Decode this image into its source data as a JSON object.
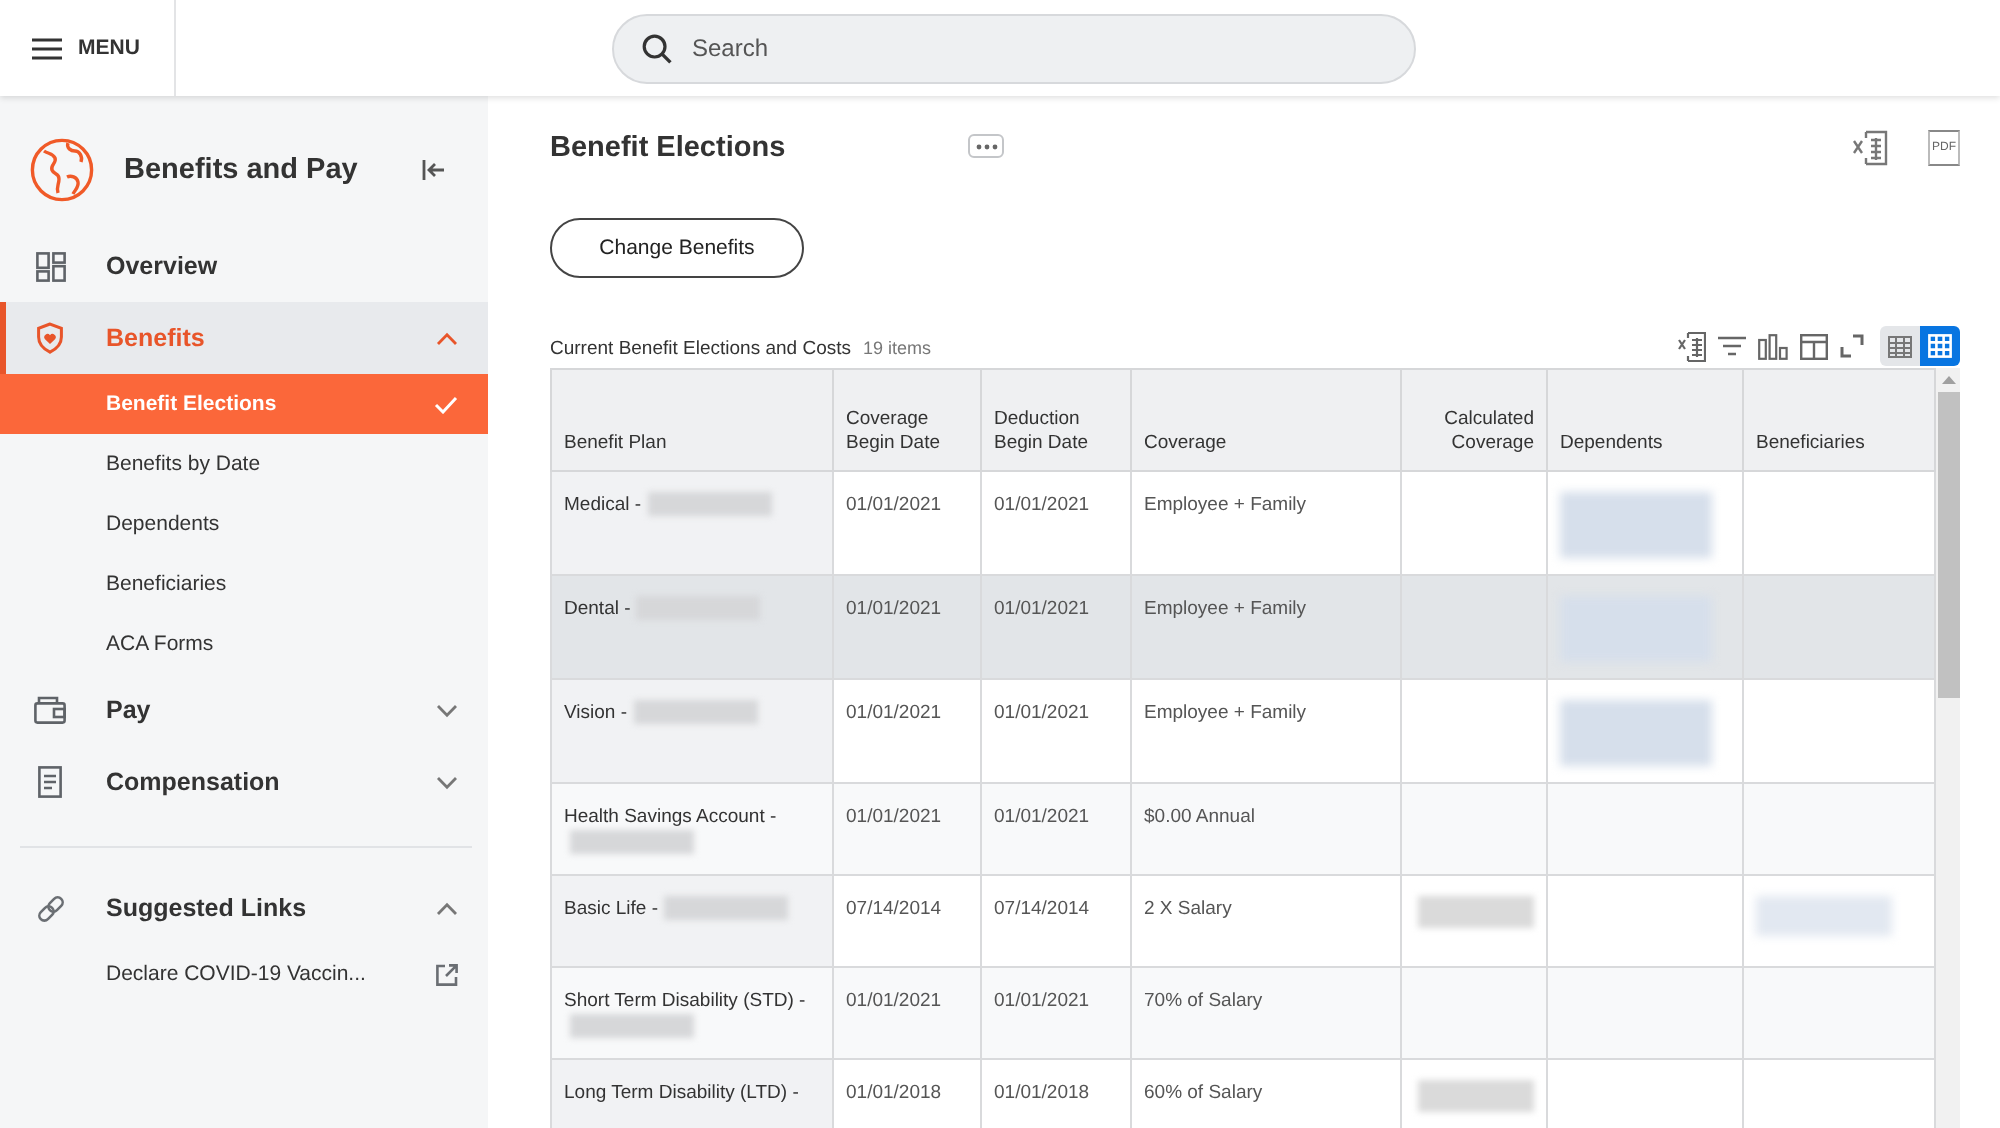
{
  "top_bar": {
    "menu_label": "MENU",
    "search": {
      "placeholder": "Search"
    }
  },
  "sidebar": {
    "title": "Benefits and Pay",
    "nav": [
      {
        "kind": "link",
        "label": "Overview",
        "selected": false
      },
      {
        "kind": "group",
        "label": "Benefits",
        "selected": true,
        "expanded": true,
        "children": [
          {
            "label": "Benefit Elections",
            "selected": true
          },
          {
            "label": "Benefits by Date",
            "selected": false
          },
          {
            "label": "Dependents",
            "selected": false
          },
          {
            "label": "Beneficiaries",
            "selected": false
          },
          {
            "label": "ACA Forms",
            "selected": false
          }
        ]
      },
      {
        "kind": "group",
        "label": "Pay",
        "selected": false,
        "expanded": false
      },
      {
        "kind": "group",
        "label": "Compensation",
        "selected": false,
        "expanded": false
      }
    ],
    "suggested": {
      "label": "Suggested Links",
      "expanded": true,
      "links": [
        {
          "label": "Declare COVID-19 Vaccin..."
        }
      ]
    }
  },
  "page": {
    "title": "Benefit Elections",
    "export_pdf_label": "PDF",
    "actions": [
      "Change Benefits"
    ]
  },
  "table": {
    "title": "Current Benefit Elections and Costs",
    "count": "19 items",
    "view_modes": [
      {
        "selected": false
      },
      {
        "selected": true
      }
    ],
    "columns": [
      {
        "label": "Benefit Plan",
        "kind": "label"
      },
      {
        "label": "Coverage Begin Date",
        "kind": "date"
      },
      {
        "label": "Deduction Begin Date",
        "kind": "date"
      },
      {
        "label": "Coverage",
        "kind": "text"
      },
      {
        "label": "Calculated Coverage",
        "kind": "number"
      },
      {
        "label": "Dependents",
        "kind": "text"
      },
      {
        "label": "Beneficiaries",
        "kind": "text"
      }
    ],
    "rows": [
      {
        "selected": false,
        "cells": [
          {
            "text": "Medical -",
            "redacted": true
          },
          {
            "text": "01/01/2021",
            "redacted": false
          },
          {
            "text": "01/01/2021",
            "redacted": false
          },
          {
            "text": "Employee + Family",
            "redacted": false
          },
          {
            "redacted": false
          },
          {
            "redacted": true
          },
          {
            "redacted": false
          }
        ]
      },
      {
        "selected": true,
        "cells": [
          {
            "text": "Dental -",
            "redacted": true
          },
          {
            "text": "01/01/2021",
            "redacted": false
          },
          {
            "text": "01/01/2021",
            "redacted": false
          },
          {
            "text": "Employee + Family",
            "redacted": false
          },
          {
            "redacted": false
          },
          {
            "redacted": true
          },
          {
            "redacted": false
          }
        ]
      },
      {
        "selected": false,
        "cells": [
          {
            "text": "Vision -",
            "redacted": true
          },
          {
            "text": "01/01/2021",
            "redacted": false
          },
          {
            "text": "01/01/2021",
            "redacted": false
          },
          {
            "text": "Employee + Family",
            "redacted": false
          },
          {
            "redacted": false
          },
          {
            "redacted": true
          },
          {
            "redacted": false
          }
        ]
      },
      {
        "selected": false,
        "cells": [
          {
            "text": "Health Savings Account -",
            "redacted": true
          },
          {
            "text": "01/01/2021",
            "redacted": false
          },
          {
            "text": "01/01/2021",
            "redacted": false
          },
          {
            "text": "$0.00 Annual",
            "redacted": false
          },
          {
            "redacted": false
          },
          {
            "redacted": false
          },
          {
            "redacted": false
          }
        ]
      },
      {
        "selected": false,
        "cells": [
          {
            "text": "Basic Life -",
            "redacted": true
          },
          {
            "text": "07/14/2014",
            "redacted": false
          },
          {
            "text": "07/14/2014",
            "redacted": false
          },
          {
            "text": "2 X Salary",
            "redacted": false
          },
          {
            "redacted": true
          },
          {
            "redacted": false
          },
          {
            "redacted": true
          }
        ]
      },
      {
        "selected": false,
        "cells": [
          {
            "text": "Short Term Disability (STD) -",
            "redacted": true
          },
          {
            "text": "01/01/2021",
            "redacted": false
          },
          {
            "text": "01/01/2021",
            "redacted": false
          },
          {
            "text": "70% of Salary",
            "redacted": false
          },
          {
            "redacted": false
          },
          {
            "redacted": false
          },
          {
            "redacted": false
          }
        ]
      },
      {
        "selected": false,
        "cells": [
          {
            "text": "Long Term Disability (LTD) -",
            "redacted": false
          },
          {
            "text": "01/01/2018",
            "redacted": false
          },
          {
            "text": "01/01/2018",
            "redacted": false
          },
          {
            "text": "60% of Salary",
            "redacted": false
          },
          {
            "redacted": true
          },
          {
            "redacted": false
          },
          {
            "redacted": false
          }
        ]
      }
    ]
  }
}
